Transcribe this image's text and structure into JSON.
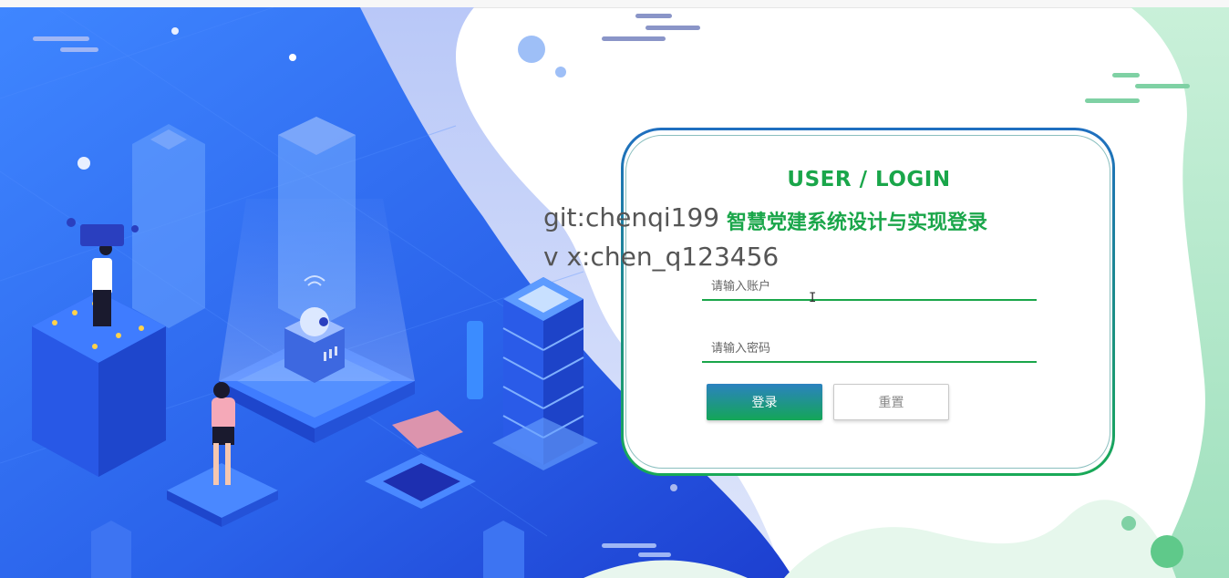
{
  "login": {
    "title": "USER / LOGIN",
    "username_placeholder": "请输入账户",
    "password_placeholder": "请输入密码",
    "login_button": "登录",
    "reset_button": "重置"
  },
  "page": {
    "subtitle": "智慧党建系统设计与实现登录"
  },
  "watermark": {
    "line1": "git:chenqi199",
    "line2": "v x:chen_q123456"
  },
  "colors": {
    "accent_green": "#1aa64a",
    "accent_blue": "#1f6fc0",
    "background_blue": "#2f6ef0"
  }
}
